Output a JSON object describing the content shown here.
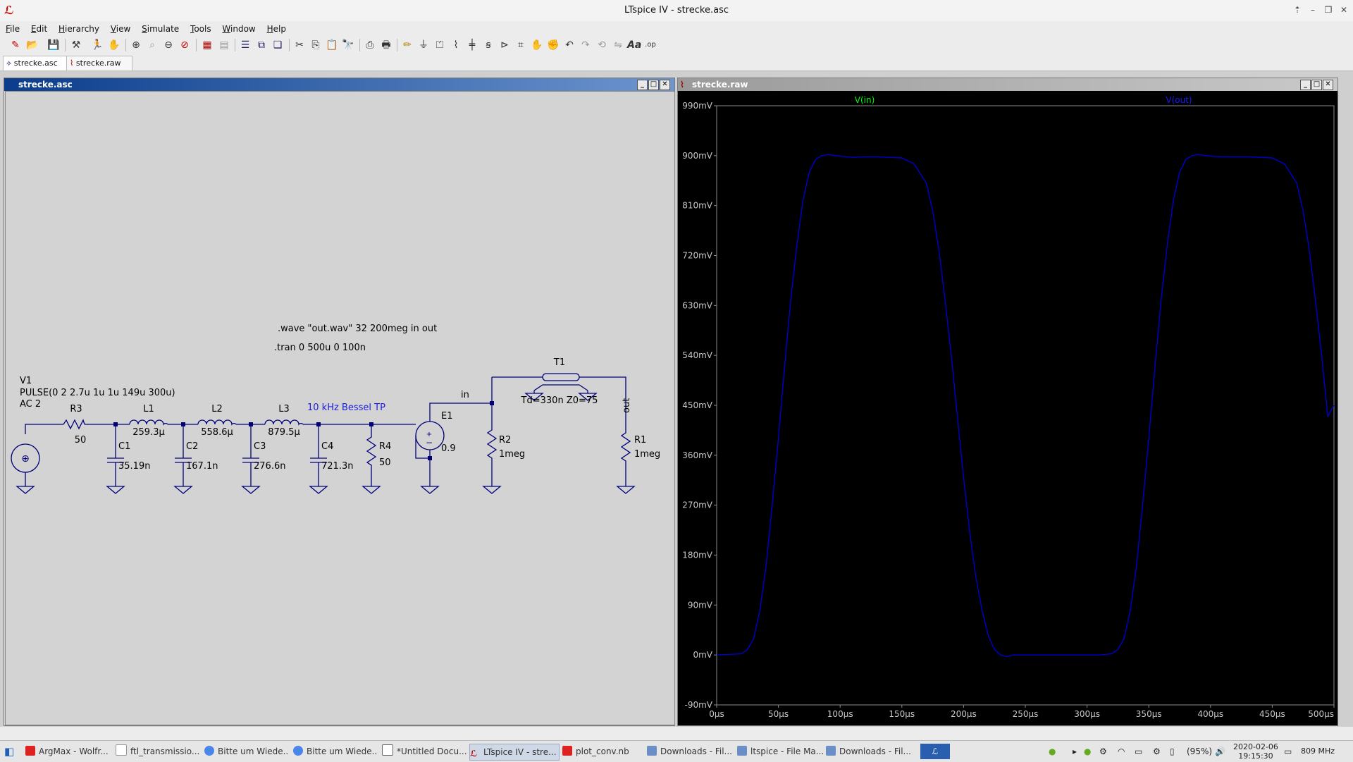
{
  "window": {
    "title": "LTspice IV - strecke.asc",
    "app_logo": "LTspice-logo-icon",
    "controls": [
      "up-icon",
      "minimize-icon",
      "restore-icon",
      "close-icon"
    ]
  },
  "menu": [
    "File",
    "Edit",
    "Hierarchy",
    "View",
    "Simulate",
    "Tools",
    "Window",
    "Help"
  ],
  "toolbar_icons": [
    "new-schematic-icon",
    "open-icon",
    "save-icon",
    "control-panel-icon",
    "run-icon",
    "halt-icon",
    "zoom-in-icon",
    "zoom-fit-icon",
    "zoom-out-icon",
    "zoom-cancel-icon",
    "autorange-icon",
    "grid-icon",
    "tile-horizontal-icon",
    "tile-vertical-icon",
    "cascade-icon",
    "cut-icon",
    "copy-icon",
    "paste-icon",
    "find-icon",
    "print-setup-icon",
    "print-icon",
    "wire-icon",
    "ground-icon",
    "label-net-icon",
    "resistor-icon",
    "capacitor-icon",
    "inductor-icon",
    "diode-icon",
    "component-icon",
    "move-icon",
    "drag-icon",
    "undo-icon",
    "redo-icon",
    "rotate-icon",
    "mirror-icon",
    "text-icon",
    "spice-directive-icon"
  ],
  "doc_tabs": [
    {
      "label": "strecke.asc",
      "icon": "schematic-icon"
    },
    {
      "label": "strecke.raw",
      "icon": "waveform-icon"
    }
  ],
  "schematic_window": {
    "title": "strecke.asc",
    "directives": [
      ".wave \"out.wav\" 32 200meg in out",
      ".tran 0 500u 0 100n"
    ],
    "source": {
      "name": "V1",
      "value": "PULSE(0 2 2.7u 1u 1u 149u 300u)",
      "ac": "AC 2"
    },
    "filter_label": "10 kHz Bessel TP",
    "components": [
      {
        "ref": "R3",
        "value": "50"
      },
      {
        "ref": "L1",
        "value": "259.3µ"
      },
      {
        "ref": "L2",
        "value": "558.6µ"
      },
      {
        "ref": "L3",
        "value": "879.5µ"
      },
      {
        "ref": "C1",
        "value": "35.19n"
      },
      {
        "ref": "C2",
        "value": "167.1n"
      },
      {
        "ref": "C3",
        "value": "276.6n"
      },
      {
        "ref": "C4",
        "value": "721.3n"
      },
      {
        "ref": "R4",
        "value": "50"
      },
      {
        "ref": "E1",
        "value": "0.9"
      },
      {
        "ref": "R2",
        "value": "1meg"
      },
      {
        "ref": "R1",
        "value": "1meg"
      },
      {
        "ref": "T1",
        "value": "Td=330n Z0=75"
      }
    ],
    "net_labels": [
      "in",
      "out"
    ]
  },
  "plot_window": {
    "title": "strecke.raw"
  },
  "chart_data": {
    "type": "line",
    "title": "",
    "xlabel": "",
    "ylabel": "",
    "xlim": [
      0,
      500
    ],
    "ylim": [
      -90,
      990
    ],
    "x_unit": "µs",
    "y_unit": "mV",
    "x_ticks": [
      "0µs",
      "50µs",
      "100µs",
      "150µs",
      "200µs",
      "250µs",
      "300µs",
      "350µs",
      "400µs",
      "450µs",
      "500µs"
    ],
    "y_ticks": [
      "990mV",
      "900mV",
      "810mV",
      "720mV",
      "630mV",
      "540mV",
      "450mV",
      "360mV",
      "270mV",
      "180mV",
      "90mV",
      "0mV",
      "-90mV"
    ],
    "legend": [
      "V(in)",
      "V(out)"
    ],
    "legend_colors": [
      "#00ff00",
      "#0000ff"
    ],
    "grid": false,
    "series": [
      {
        "name": "V(out)",
        "color": "#0000cc",
        "x": [
          0,
          20,
          25,
          30,
          35,
          40,
          45,
          50,
          55,
          60,
          65,
          70,
          75,
          80,
          85,
          90,
          100,
          110,
          120,
          130,
          140,
          150,
          160,
          170,
          175,
          180,
          185,
          190,
          195,
          200,
          205,
          210,
          215,
          220,
          225,
          230,
          235,
          240,
          250,
          260,
          270,
          280,
          290,
          300,
          310,
          320,
          325,
          330,
          335,
          340,
          345,
          350,
          355,
          360,
          365,
          370,
          375,
          380,
          385,
          390,
          400,
          410,
          420,
          430,
          440,
          450,
          460,
          470,
          475,
          480,
          485,
          490,
          495,
          500
        ],
        "y": [
          0,
          2,
          10,
          30,
          80,
          160,
          270,
          390,
          520,
          640,
          740,
          820,
          870,
          893,
          900,
          902,
          899,
          897,
          898,
          898,
          897,
          896,
          885,
          850,
          800,
          730,
          640,
          540,
          430,
          320,
          220,
          140,
          80,
          35,
          10,
          0,
          -3,
          0,
          0,
          0,
          0,
          0,
          0,
          0,
          0,
          2,
          10,
          30,
          80,
          160,
          270,
          390,
          520,
          640,
          740,
          820,
          870,
          893,
          900,
          902,
          899,
          898,
          898,
          898,
          897,
          896,
          885,
          850,
          800,
          730,
          640,
          540,
          430,
          450
        ]
      }
    ]
  },
  "taskbar": {
    "start_icon": "start-menu-icon",
    "tasks": [
      {
        "label": "ArgMax - Wolfr...",
        "icon": "wolfram-icon"
      },
      {
        "label": "ftl_transmissio...",
        "icon": "document-icon"
      },
      {
        "label": "Bitte um Wiede...",
        "icon": "chrome-icon"
      },
      {
        "label": "Bitte um Wiede...",
        "icon": "chrome-icon"
      },
      {
        "label": "*Untitled Docu...",
        "icon": "text-editor-icon"
      },
      {
        "label": "LTspice IV - stre...",
        "icon": "LTspice-logo-icon"
      },
      {
        "label": "plot_conv.nb",
        "icon": "wolfram-icon"
      },
      {
        "label": "Downloads - Fil...",
        "icon": "folder-icon"
      },
      {
        "label": "ltspice - File Ma...",
        "icon": "folder-icon"
      },
      {
        "label": "Downloads - Fil...",
        "icon": "folder-icon"
      }
    ],
    "tray": {
      "battery": "(95%)",
      "date": "2020-02-06",
      "time": "19:15:30",
      "cpu": "809 MHz"
    }
  }
}
